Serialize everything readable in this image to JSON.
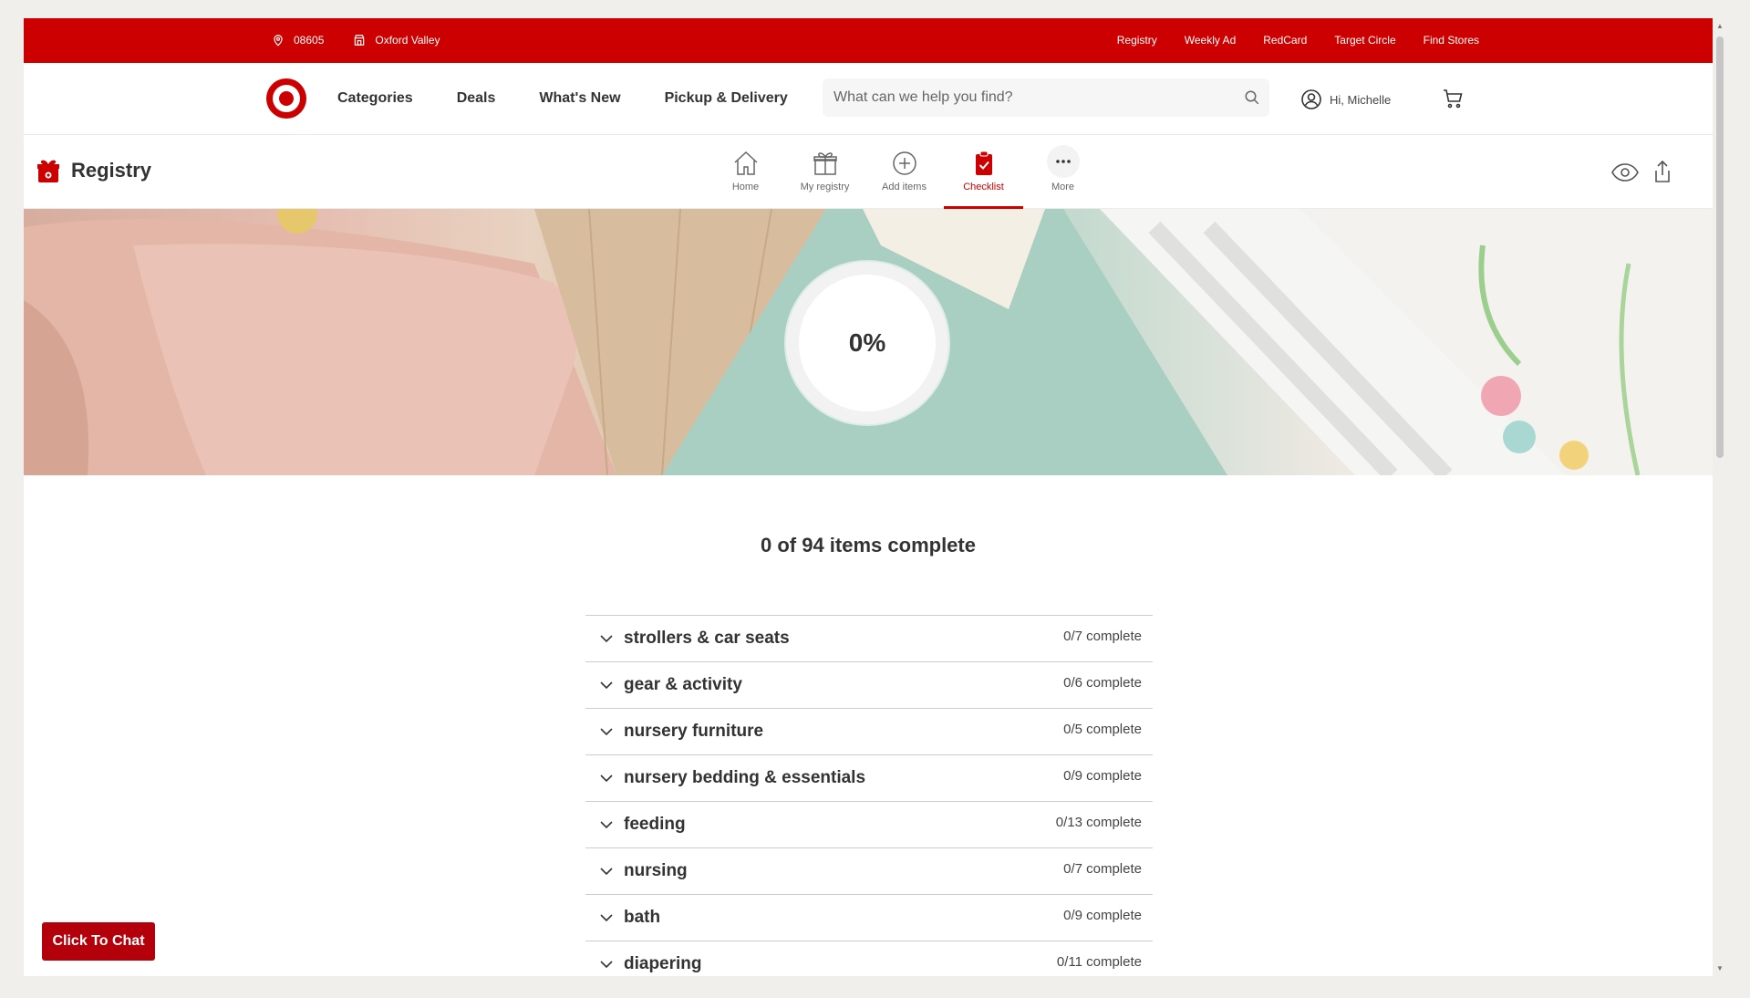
{
  "topbar": {
    "zip": "08605",
    "store": "Oxford Valley",
    "links": [
      "Registry",
      "Weekly Ad",
      "RedCard",
      "Target Circle",
      "Find Stores"
    ]
  },
  "header": {
    "nav": [
      "Categories",
      "Deals",
      "What's New",
      "Pickup & Delivery"
    ],
    "search_placeholder": "What can we help you find?",
    "account_label": "Hi, Michelle"
  },
  "registry": {
    "title": "Registry",
    "tabs": [
      {
        "label": "Home",
        "icon": "home-icon"
      },
      {
        "label": "My registry",
        "icon": "gift-icon"
      },
      {
        "label": "Add items",
        "icon": "plus-circle-icon"
      },
      {
        "label": "Checklist",
        "icon": "clipboard-check-icon"
      },
      {
        "label": "More",
        "icon": "ellipsis-icon"
      }
    ],
    "active_tab": "Checklist"
  },
  "hero": {
    "progress_text": "0%",
    "progress": 0
  },
  "summary": "0 of 94 items complete",
  "checklist": [
    {
      "label": "strollers & car seats",
      "count": "0/7 complete"
    },
    {
      "label": "gear & activity",
      "count": "0/6 complete"
    },
    {
      "label": "nursery furniture",
      "count": "0/5 complete"
    },
    {
      "label": "nursery bedding & essentials",
      "count": "0/9 complete"
    },
    {
      "label": "feeding",
      "count": "0/13 complete"
    },
    {
      "label": "nursing",
      "count": "0/7 complete"
    },
    {
      "label": "bath",
      "count": "0/9 complete"
    },
    {
      "label": "diapering",
      "count": "0/11 complete"
    }
  ],
  "chat_label": "Click To Chat",
  "colors": {
    "brand": "#cc0000",
    "chat": "#b3000a"
  }
}
